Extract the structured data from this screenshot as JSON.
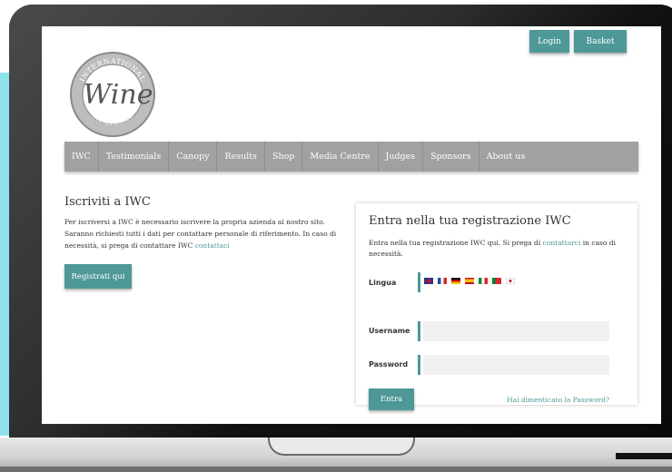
{
  "header": {
    "logo_text_top": "INTERNATIONAL",
    "logo_text_main": "Wine",
    "logo_text_bottom": "CHALLENGE",
    "login_label": "Login",
    "basket_label": "Basket"
  },
  "nav": {
    "items": [
      "IWC",
      "Testimonials",
      "Canopy",
      "Results",
      "Shop",
      "Media Centre",
      "Judges",
      "Sponsors",
      "About us"
    ]
  },
  "left": {
    "title": "Iscriviti a IWC",
    "text": "Per iscriversi a IWC è necessario iscrivere la propria azienda al nostro sito. Saranno richiesti tutti i dati per contattare personale di riferimento. In caso di necessità, si prega di contattare IWC",
    "link": "contattaci",
    "button": "Registrati qui"
  },
  "login_card": {
    "title": "Entra nella tua registrazione IWC",
    "text_before": "Entra nella tua registrazione IWC qui. Si prega di",
    "link": "contattarci",
    "text_after": "in caso di necessità.",
    "language_label": "Lingua",
    "username_label": "Username",
    "password_label": "Password",
    "username_value": "",
    "password_value": "",
    "submit_label": "Entra",
    "forgot_label": "Hai dimenticato la Password?",
    "flags": [
      "gb-flag-icon",
      "fr-flag-icon",
      "de-flag-icon",
      "es-flag-icon",
      "it-flag-icon",
      "pt-flag-icon",
      "jp-flag-icon"
    ]
  },
  "colors": {
    "accent": "#4e9897",
    "nav_bg": "#a1a1a1",
    "input_bg": "#f1f1f1"
  }
}
